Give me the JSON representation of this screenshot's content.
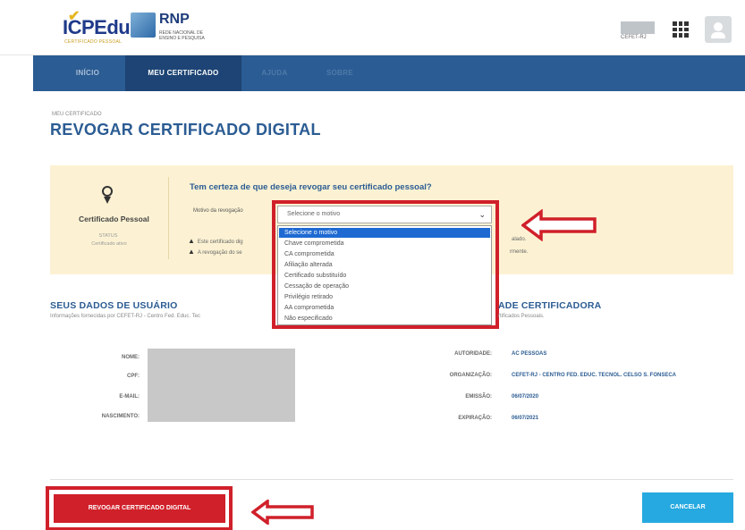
{
  "header": {
    "logo_icp": "ICPEdu",
    "logo_icp_sub": "CERTIFICADO PESSOAL",
    "logo_rnp": "RNP",
    "logo_rnp_sub": "REDE NACIONAL DE ENSINO E PESQUISA",
    "institution": "CEFET-RJ"
  },
  "nav": {
    "items": [
      {
        "label": "INÍCIO"
      },
      {
        "label": "MEU CERTIFICADO"
      },
      {
        "label": "AJUDA"
      },
      {
        "label": "SOBRE"
      }
    ],
    "active_index": 1
  },
  "page": {
    "breadcrumb": "MEU CERTIFICADO",
    "title": "REVOGAR CERTIFICADO DIGITAL"
  },
  "certificate": {
    "name": "Certificado Pessoal",
    "status_label": "STATUS",
    "status_value": "Certificado ativo"
  },
  "revoke_form": {
    "question": "Tem certeza de que deseja revogar seu certificado pessoal?",
    "reason_label": "Motivo da revogação",
    "reason_selected": "Selecione o motivo",
    "reason_options": [
      "Selecione o motivo",
      "Chave comprometida",
      "CA comprometida",
      "Afiliação alterada",
      "Certificado substituído",
      "Cessação de operação",
      "Privilégio retirado",
      "AA comprometida",
      "Não especificado"
    ],
    "warning_1_start": "Este certificado dig",
    "warning_1_end": "alado.",
    "warning_2_start": "A revogação do se",
    "warning_2_end": "rmente."
  },
  "user_section": {
    "title": "SEUS DADOS DE USUÁRIO",
    "subtitle": "Informações fornecidas por CEFET-RJ - Centro Fed. Educ. Tec",
    "fields": [
      {
        "label": "NOME:"
      },
      {
        "label": "CPF:"
      },
      {
        "label": "E-MAIL:"
      },
      {
        "label": "NASCIMENTO:"
      }
    ]
  },
  "ca_section": {
    "title": "ADE CERTIFICADORA",
    "subtitle": "rtificados Pessoais.",
    "fields": [
      {
        "label": "AUTORIDADE:",
        "value": "AC PESSOAS"
      },
      {
        "label": "ORGANIZAÇÃO:",
        "value": "CEFET-RJ - CENTRO FED. EDUC. TECNOL. CELSO S. FONSECA"
      },
      {
        "label": "EMISSÃO:",
        "value": "06/07/2020"
      },
      {
        "label": "EXPIRAÇÃO:",
        "value": "06/07/2021"
      }
    ]
  },
  "actions": {
    "revoke_label": "REVOGAR CERTIFICADO DIGITAL",
    "cancel_label": "CANCELAR"
  },
  "colors": {
    "nav_bg": "#2b5c93",
    "nav_active": "#1d4474",
    "title_blue": "#2b5c93",
    "panel_bg": "#fcf2d3",
    "annotation_red": "#d0202a",
    "cancel_blue": "#26a9e0",
    "selected_option": "#1e6ad2"
  }
}
